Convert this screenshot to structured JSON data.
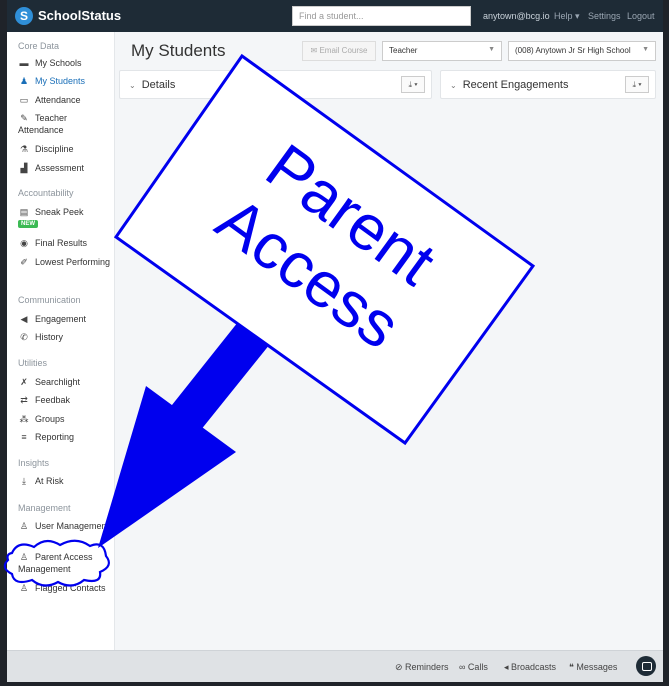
{
  "app": {
    "brand": "SchoolStatus",
    "logo_letter": "S"
  },
  "topbar": {
    "search_placeholder": "Find a student...",
    "user": "anytown@bcg.io",
    "help": "Help ▾",
    "settings": "Settings",
    "logout": "Logout"
  },
  "sidebar": {
    "sections": [
      {
        "title": "Core Data",
        "items": [
          {
            "label": "My Schools",
            "icon": "school-icon"
          },
          {
            "label": "My Students",
            "icon": "students-icon",
            "active": true
          },
          {
            "label": "Attendance",
            "icon": "calendar-icon"
          },
          {
            "label": "Teacher Attendance",
            "icon": "pencil-icon"
          },
          {
            "label": "Discipline",
            "icon": "flask-icon"
          },
          {
            "label": "Assessment",
            "icon": "chart-icon"
          }
        ]
      },
      {
        "title": "Accountability",
        "items": [
          {
            "label": "Sneak Peek",
            "icon": "document-icon",
            "badge": "NEW"
          },
          {
            "label": "Final Results",
            "icon": "eye-icon"
          },
          {
            "label": "Lowest Performing",
            "icon": "pencil-icon"
          }
        ]
      },
      {
        "title": "Communication",
        "items": [
          {
            "label": "Engagement",
            "icon": "megaphone-icon"
          },
          {
            "label": "History",
            "icon": "phone-icon"
          }
        ]
      },
      {
        "title": "Utilities",
        "items": [
          {
            "label": "Searchlight",
            "icon": "wrench-icon"
          },
          {
            "label": "Feedbak",
            "icon": "retweet-icon"
          },
          {
            "label": "Groups",
            "icon": "groups-icon"
          },
          {
            "label": "Reporting",
            "icon": "list-icon"
          }
        ]
      },
      {
        "title": "Insights",
        "items": [
          {
            "label": "At Risk",
            "icon": "download-icon"
          }
        ]
      },
      {
        "title": "Management",
        "items": [
          {
            "label": "User Management",
            "icon": "user-icon"
          },
          {
            "label": "Parent Access Management",
            "icon": "user-plus-icon"
          },
          {
            "label": "Flagged Contacts",
            "icon": "user-flag-icon"
          }
        ]
      }
    ]
  },
  "main": {
    "title": "My Students",
    "email_course": "Email Course",
    "role_select": "Teacher",
    "school_select": "(008) Anytown Jr Sr High School",
    "panels": [
      {
        "label": "Details"
      },
      {
        "label": "Recent Engagements"
      }
    ]
  },
  "bottom": {
    "reminders": "Reminders",
    "calls": "Calls",
    "broadcasts": "Broadcasts",
    "messages": "Messages"
  },
  "annotation": {
    "line1": "Parent",
    "line2": "Access"
  },
  "colors": {
    "topbar": "#1e2b36",
    "active": "#1a6fb8",
    "annotation": "#0000ee"
  }
}
